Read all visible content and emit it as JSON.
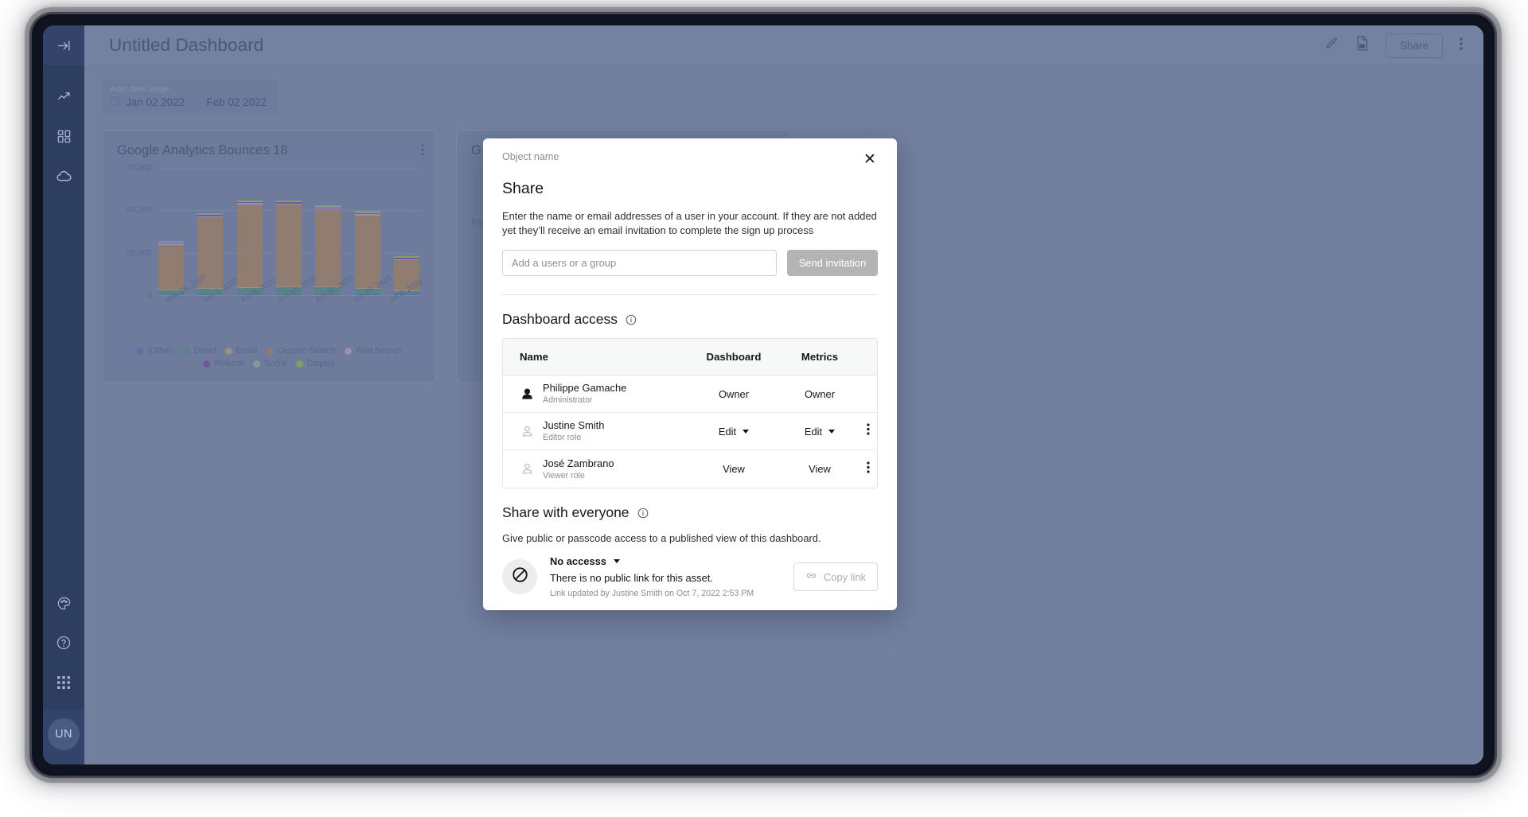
{
  "sidebar": {
    "top_icon": "collapse-panel-icon",
    "items": [
      {
        "icon": "trending-up-icon",
        "name": "analytics"
      },
      {
        "icon": "grid-dashboard-icon",
        "name": "dashboards"
      },
      {
        "icon": "cloud-icon",
        "name": "data-sources"
      }
    ],
    "bottom_items": [
      {
        "icon": "palette-icon",
        "name": "theme"
      },
      {
        "icon": "help-circle-icon",
        "name": "help"
      },
      {
        "icon": "apps-grid-icon",
        "name": "apps"
      }
    ],
    "avatar_initials": "UN"
  },
  "topbar": {
    "title": "Untitled Dashboard",
    "edit_icon": "pencil-icon",
    "pdf_icon": "pdf-file-icon",
    "share_label": "Share",
    "more_icon": "kebab-menu-icon"
  },
  "date_range": {
    "label": "Auto date range",
    "calendar_icon": "calendar-icon",
    "start": "Jan 02 2022",
    "arrow": "→",
    "end": "Feb 02 2022"
  },
  "cards": [
    {
      "title": "Google Analytics Bounces 18",
      "kebab_icon": "kebab-menu-icon"
    },
    {
      "title": "G",
      "partial_legend": "Paid"
    }
  ],
  "chart_data": {
    "type": "bar",
    "stacked": true,
    "title": "Google Analytics Bounces 18",
    "xlabel": "",
    "ylabel": "",
    "ylim": [
      0,
      75000
    ],
    "yticks": [
      0,
      25000,
      50000,
      75000
    ],
    "ytick_labels": [
      "0",
      "25,000",
      "50,000",
      "75,000"
    ],
    "grid": true,
    "legend_position": "bottom",
    "categories": [
      "May 25, 2020",
      "Jun 1, 2020",
      "Jun 8, 2020",
      "Jun 15, 2020",
      "Jun 22, 2020",
      "Jun 29, 2020",
      "Jul 6, 2020"
    ],
    "series": [
      {
        "name": "(Other)",
        "color": "#4a72a8",
        "values": [
          300,
          350,
          400,
          400,
          350,
          350,
          1600
        ]
      },
      {
        "name": "Direct",
        "color": "#4e8b7e",
        "values": [
          2400,
          3300,
          3800,
          4000,
          4200,
          3300,
          900
        ]
      },
      {
        "name": "Email",
        "color": "#c3a270",
        "values": [
          150,
          150,
          150,
          150,
          150,
          150,
          150
        ]
      },
      {
        "name": "Organic Search",
        "color": "#b08050",
        "values": [
          26200,
          41600,
          48700,
          48400,
          45300,
          42700,
          17700
        ]
      },
      {
        "name": "Paid Search",
        "color": "#c5a3cd",
        "values": [
          150,
          150,
          150,
          150,
          150,
          150,
          150
        ]
      },
      {
        "name": "Referral",
        "color": "#7b3fa0",
        "values": [
          300,
          300,
          350,
          800,
          400,
          300,
          300
        ]
      },
      {
        "name": "Social",
        "color": "#9db896",
        "values": [
          100,
          100,
          100,
          100,
          100,
          700,
          400
        ]
      },
      {
        "name": "Display",
        "color": "#8cbf3f",
        "values": [
          80,
          80,
          80,
          80,
          80,
          80,
          80
        ]
      }
    ]
  },
  "modal": {
    "object_name": "Object name",
    "close_icon": "close-icon",
    "title": "Share",
    "description": "Enter the name or email addresses of a user in your account. If they are not added yet they’ll receive an email invitation to complete the sign up process",
    "invite_placeholder": "Add a users or a group",
    "invite_value": "",
    "send_label": "Send invitation",
    "access_section": {
      "title": "Dashboard access",
      "info_icon": "info-circle-icon",
      "columns": [
        "Name",
        "Dashboard",
        "Metrics"
      ],
      "rows": [
        {
          "name": "Philippe Gamache",
          "role": "Administrator",
          "avatar_icon": "person-icon",
          "dashboard": "Owner",
          "dashboard_dropdown": false,
          "metrics": "Owner",
          "metrics_dropdown": false,
          "has_menu": false,
          "menu_icon": "kebab-menu-icon"
        },
        {
          "name": "Justine Smith",
          "role": "Editor role",
          "avatar_icon": "person-icon",
          "dashboard": "Edit",
          "dashboard_dropdown": true,
          "metrics": "Edit",
          "metrics_dropdown": true,
          "has_menu": true,
          "menu_icon": "kebab-menu-icon"
        },
        {
          "name": "José Zambrano",
          "role": "Viewer role",
          "avatar_icon": "person-icon",
          "dashboard": "View",
          "dashboard_dropdown": false,
          "metrics": "View",
          "metrics_dropdown": false,
          "has_menu": true,
          "menu_icon": "kebab-menu-icon"
        }
      ]
    },
    "public_section": {
      "title": "Share with everyone",
      "info_icon": "info-circle-icon",
      "description": "Give public or passcode access to a published view of this dashboard.",
      "status_icon": "no-access-icon",
      "access_label": "No accesss",
      "no_link_text": "There is no public link for this asset.",
      "updated_text": "Link updated by Justine Smith on Oct 7, 2022 2:53 PM",
      "copy_icon": "link-icon",
      "copy_label": "Copy link"
    }
  },
  "colors": {
    "sidebar": "#2e3e60",
    "canvas": "#7886a6",
    "topbar": "#7d8aa9",
    "accent": "#3b4c72",
    "disabled_button": "#b4b4b4"
  }
}
